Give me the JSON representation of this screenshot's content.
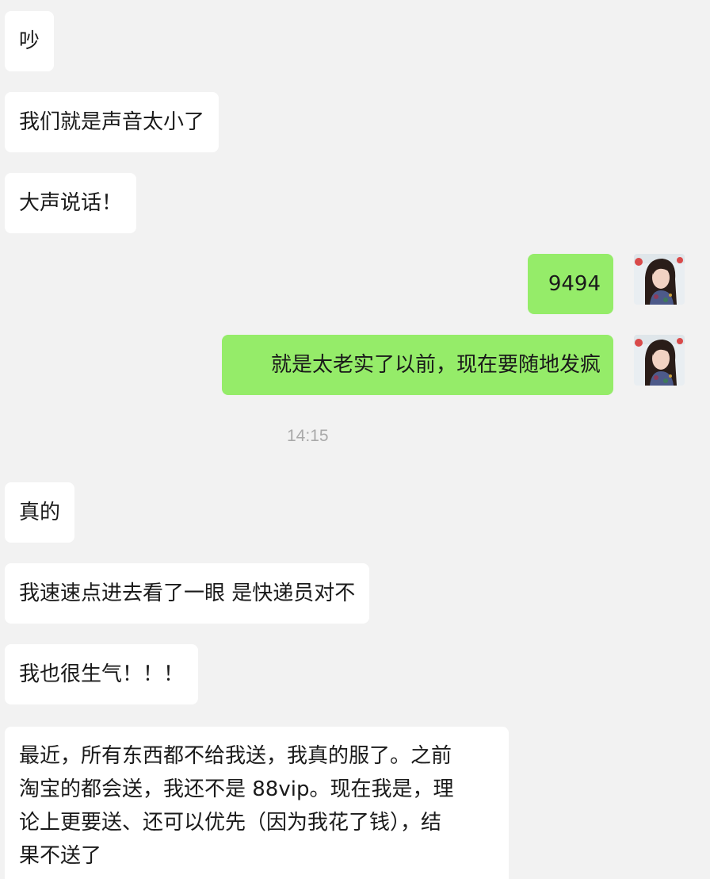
{
  "messages": {
    "m1": "吵",
    "m2": "我们就是声音太小了",
    "m3": "大声说话！",
    "m4": "9494",
    "m5": "就是太老实了以前，现在要随地发疯",
    "time": "14:15",
    "m6": "真的",
    "m7": "我速速点进去看了一眼 是快递员对不",
    "m8": "我也很生气！！！",
    "m9": [
      "最近，所有东西都不给我送，我真的服了。之前",
      "淘宝的都会送，我还不是 88vip。现在我是，理",
      "论上更要送、还可以优先（因为我花了钱），结",
      "果不送了"
    ]
  },
  "colors": {
    "background": "#f2f2f2",
    "incoming_bubble": "#ffffff",
    "outgoing_bubble": "#95ec69",
    "timestamp": "#a9a9a9"
  }
}
